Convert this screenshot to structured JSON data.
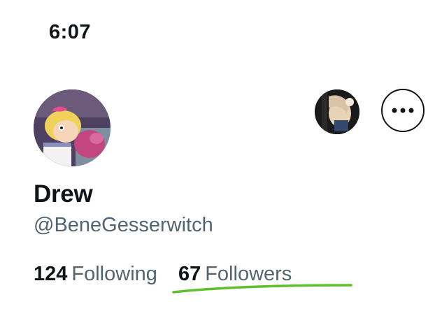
{
  "status_bar": {
    "time": "6:07"
  },
  "profile": {
    "display_name": "Drew",
    "handle": "@BeneGesserwitch",
    "following": {
      "count": "124",
      "label": "Following"
    },
    "followers": {
      "count": "67",
      "label": "Followers"
    }
  },
  "icons": {
    "more": "more-horizontal-icon"
  },
  "colors": {
    "text_primary": "#0f1419",
    "text_secondary": "#536471",
    "annotation_underline": "#5fbf2e"
  }
}
